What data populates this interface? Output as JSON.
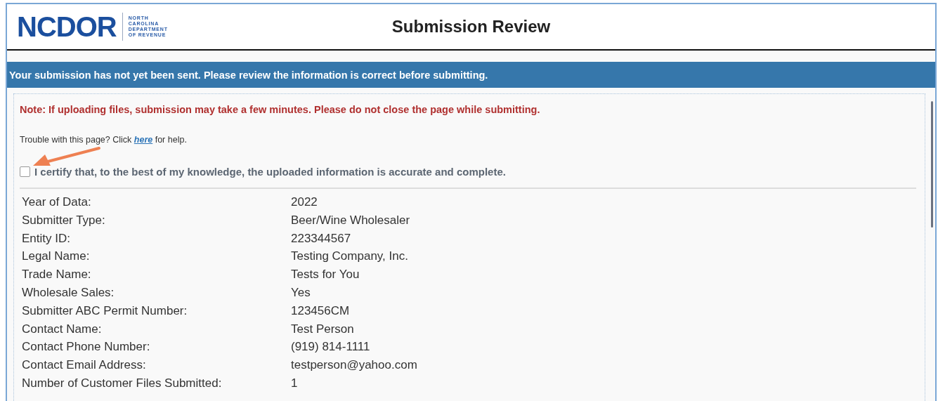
{
  "logo": {
    "wordmark": "NCDOR",
    "agency_lines": [
      "NORTH",
      "CAROLINA",
      "DEPARTMENT",
      "OF REVENUE"
    ]
  },
  "title": "Submission Review",
  "banner": "Your submission has not yet been sent. Please review the information is correct before submitting.",
  "note": "Note: If uploading files, submission may take a few minutes. Please do not close the page while submitting.",
  "help": {
    "before": "Trouble with this page? Click",
    "link": "here",
    "after": "for help."
  },
  "certify": {
    "label": "I certify that, to the best of my knowledge, the uploaded information is accurate and complete.",
    "checked": false
  },
  "fields": [
    {
      "label": "Year of Data:",
      "value": "2022"
    },
    {
      "label": "Submitter Type:",
      "value": "Beer/Wine Wholesaler"
    },
    {
      "label": "Entity ID:",
      "value": "223344567"
    },
    {
      "label": "Legal Name:",
      "value": "Testing Company, Inc."
    },
    {
      "label": "Trade Name:",
      "value": "Tests for You"
    },
    {
      "label": "Wholesale Sales:",
      "value": "Yes"
    },
    {
      "label": "Submitter ABC Permit Number:",
      "value": "123456CM"
    },
    {
      "label": "Contact Name:",
      "value": "Test Person"
    },
    {
      "label": "Contact Phone Number:",
      "value": "(919) 814-1111"
    },
    {
      "label": "Contact Email Address:",
      "value": "testperson@yahoo.com"
    },
    {
      "label": "Number of Customer Files Submitted:",
      "value": "1"
    }
  ]
}
